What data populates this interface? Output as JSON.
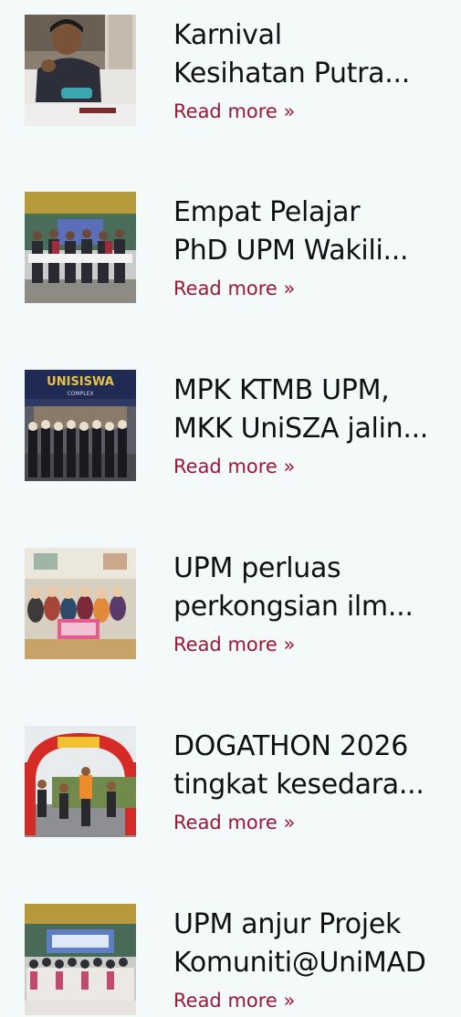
{
  "colors": {
    "background": "#f4f9fa",
    "title": "#111111",
    "link": "#9b1736"
  },
  "news": [
    {
      "title_line1": "Karnival",
      "title_line2": "Kesihatan Putra...",
      "link": "Read more »",
      "thumb": "person-donating-blood-photo"
    },
    {
      "title_line1": "Empat Pelajar",
      "title_line2": "PhD UPM Wakili...",
      "link": "Read more »",
      "thumb": "group-holding-banners-photo"
    },
    {
      "title_line1": "MPK KTMB UPM,",
      "title_line2": "MKK UniSZA jalin...",
      "link": "Read more »",
      "thumb": "unisiswa-complex-group-photo",
      "sign_text": "UNISISWA",
      "sign_sub": "COMPLEX"
    },
    {
      "title_line1": "UPM perluas",
      "title_line2": "perkongsian ilm...",
      "link": "Read more »",
      "thumb": "seated-group-photo"
    },
    {
      "title_line1": "DOGATHON 2026",
      "title_line2": "tingkat kesedara...",
      "link": "Read more »",
      "thumb": "runners-under-arch-photo"
    },
    {
      "title_line1": "UPM anjur Projek",
      "title_line2": "Komuniti@UniMAD",
      "link": "Read more »",
      "thumb": "group-on-stage-photo"
    }
  ]
}
